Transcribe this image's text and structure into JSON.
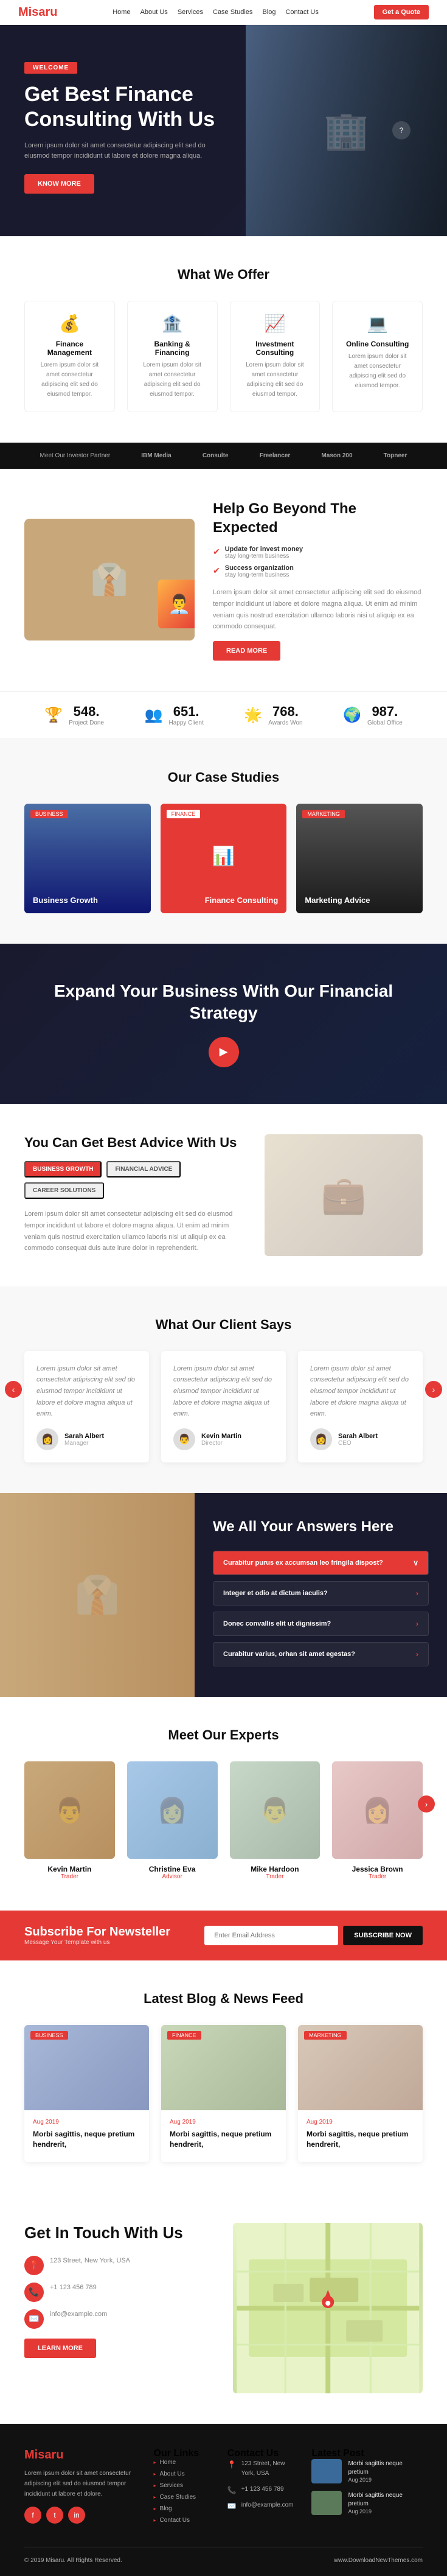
{
  "nav": {
    "logo": "Misaru",
    "links": [
      "Home",
      "About Us",
      "Services",
      "Case Studies",
      "Blog",
      "Contact Us"
    ],
    "cta": "Get a Quote"
  },
  "hero": {
    "welcome": "WELCOME",
    "headline": "Get Best Finance Consulting With Us",
    "description": "Lorem ipsum dolor sit amet consectetur adipiscing elit sed do eiusmod tempor incididunt ut labore et dolore magna aliqua.",
    "btn": "KNOW MORE"
  },
  "offer": {
    "title": "What We Offer",
    "cards": [
      {
        "icon": "💰",
        "title": "Finance Management",
        "text": "Lorem ipsum dolor sit amet consectetur adipiscing elit sed do eiusmod tempor."
      },
      {
        "icon": "🏦",
        "title": "Banking & Financing",
        "text": "Lorem ipsum dolor sit amet consectetur adipiscing elit sed do eiusmod tempor."
      },
      {
        "icon": "📈",
        "title": "Investment Consulting",
        "text": "Lorem ipsum dolor sit amet consectetur adipiscing elit sed do eiusmod tempor."
      },
      {
        "icon": "💻",
        "title": "Online Consulting",
        "text": "Lorem ipsum dolor sit amet consectetur adipiscing elit sed do eiusmod tempor."
      }
    ]
  },
  "partners": {
    "label": "Meet Our Investor Partner",
    "logos": [
      "IBM Media",
      "Consulte",
      "Freelancer",
      "Mason 200",
      "Topneer"
    ]
  },
  "help": {
    "headline": "Help Go Beyond The Expected",
    "check1_title": "Update for invest money",
    "check1_sub": "stay long-term business",
    "check2_title": "Success organization",
    "check2_sub": "stay long-term business",
    "text": "Lorem ipsum dolor sit amet consectetur adipiscing elit sed do eiusmod tempor incididunt ut labore et dolore magna aliqua. Ut enim ad minim veniam quis nostrud exercitation ullamco laboris nisi ut aliquip ex ea commodo consequat.",
    "btn": "READ MORE"
  },
  "stats": [
    {
      "icon": "🏆",
      "num": "548.",
      "label": "Project Done"
    },
    {
      "icon": "👥",
      "num": "651.",
      "label": "Happy Client"
    },
    {
      "icon": "🌟",
      "num": "768.",
      "label": "Awards Won"
    },
    {
      "icon": "🌍",
      "num": "987.",
      "label": "Global Office"
    }
  ],
  "cases": {
    "title": "Our Case Studies",
    "cards": [
      {
        "tag": "BUSINESS",
        "label": "Business Growth",
        "style": "blue"
      },
      {
        "tag": "FINANCE",
        "label": "Finance Consulting",
        "style": "red"
      },
      {
        "tag": "MARKETING",
        "label": "Marketing Advice",
        "style": "dark"
      }
    ]
  },
  "strategy": {
    "headline": "Expand Your Business With Our Financial Strategy"
  },
  "advice": {
    "headline": "You Can Get Best Advice With Us",
    "tabs": [
      "BUSINESS GROWTH",
      "FINANCIAL ADVICE",
      "CAREER SOLUTIONS"
    ],
    "text": "Lorem ipsum dolor sit amet consectetur adipiscing elit sed do eiusmod tempor incididunt ut labore et dolore magna aliqua. Ut enim ad minim veniam quis nostrud exercitation ullamco laboris nisi ut aliquip ex ea commodo consequat duis aute irure dolor in reprehenderit."
  },
  "testimonials": {
    "title": "What Our Client Says",
    "items": [
      {
        "text": "Lorem ipsum dolor sit amet consectetur adipiscing elit sed do eiusmod tempor incididunt ut labore et dolore magna aliqua ut enim.",
        "name": "Sarah Albert",
        "role": "Manager"
      },
      {
        "text": "Lorem ipsum dolor sit amet consectetur adipiscing elit sed do eiusmod tempor incididunt ut labore et dolore magna aliqua ut enim.",
        "name": "Kevin Martin",
        "role": "Director"
      },
      {
        "text": "Lorem ipsum dolor sit amet consectetur adipiscing elit sed do eiusmod tempor incididunt ut labore et dolore magna aliqua ut enim.",
        "name": "Sarah Albert",
        "role": "CEO"
      }
    ]
  },
  "faq": {
    "headline": "We All Your Answers Here",
    "items": [
      {
        "q": "Curabitur purus ex accumsan leo fringila dispost?",
        "active": true
      },
      {
        "q": "Integer et odio at dictum iaculis?",
        "active": false
      },
      {
        "q": "Donec convallis elit ut dignissim?",
        "active": false
      },
      {
        "q": "Curabitur varius, orhan sit amet egestas?",
        "active": false
      }
    ]
  },
  "team": {
    "title": "Meet Our Experts",
    "members": [
      {
        "name": "Kevin Martin",
        "role": "Trader",
        "photo": "photo1"
      },
      {
        "name": "Christine Eva",
        "role": "Advisor",
        "photo": "photo2"
      },
      {
        "name": "Mike Hardoon",
        "role": "Trader",
        "photo": "photo3"
      },
      {
        "name": "Jessica Brown",
        "role": "Trader",
        "photo": "photo4"
      }
    ]
  },
  "subscribe": {
    "title": "Subscribe For Newsteller",
    "subtitle": "Message Your Template with us",
    "placeholder": "Enter Email Address",
    "btn": "SUBSCRIBE NOW"
  },
  "blog": {
    "title": "Latest Blog & News Feed",
    "posts": [
      {
        "tag": "BUSINESS",
        "img": "b1",
        "title": "Morbi sagittis, neque pretium hendrerit,",
        "date": "Aug 2019"
      },
      {
        "tag": "FINANCE",
        "img": "b2",
        "title": "Morbi sagittis, neque pretium hendrerit,",
        "date": "Aug 2019"
      },
      {
        "tag": "MARKETING",
        "img": "b3",
        "title": "Morbi sagittis, neque pretium hendrerit,",
        "date": "Aug 2019"
      }
    ]
  },
  "contact": {
    "title": "Get In Touch With Us",
    "items": [
      {
        "icon": "📍",
        "text": "123 Street, New York, USA"
      },
      {
        "icon": "📞",
        "text": "+1 123 456 789"
      },
      {
        "icon": "✉️",
        "text": "info@example.com"
      }
    ],
    "btn": "LEARN MORE"
  },
  "footer": {
    "logo": "Misaru",
    "about": "Lorem ipsum dolor sit amet consectetur adipiscing elit sed do eiusmod tempor incididunt ut labore et dolore.",
    "links_title": "Our Links",
    "links": [
      "Home",
      "About Us",
      "Services",
      "Case Studies",
      "Blog",
      "Contact Us"
    ],
    "contact_title": "Contact Us",
    "contact_items": [
      "123 Street, New York, USA",
      "+1 123 456 789",
      "info@example.com"
    ],
    "latest_title": "Latest Post",
    "posts": [
      {
        "title": "Morbi sagittis neque pretium",
        "date": "Aug 2019"
      },
      {
        "title": "Morbi sagittis neque pretium",
        "date": "Aug 2019"
      }
    ],
    "copy": "© 2019 Misaru. All Rights Reserved.",
    "watermark": "www.DownloadNewThemes.com"
  }
}
